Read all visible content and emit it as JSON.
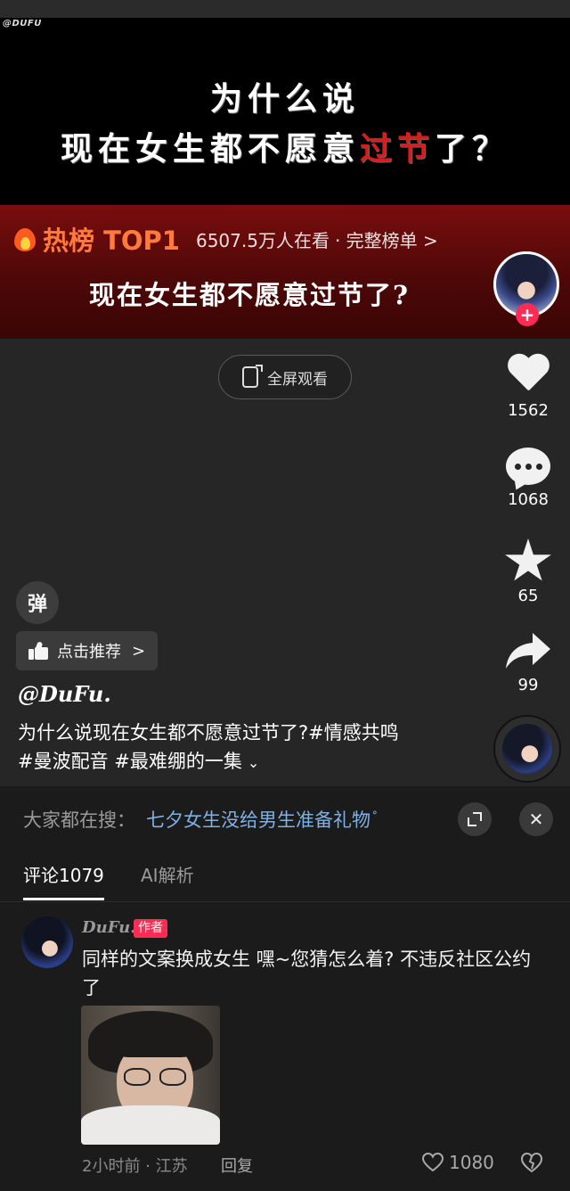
{
  "video": {
    "watermark": "@DUFU",
    "title_line1": "为什么说",
    "title_line2_prefix": "现在女生都不愿意",
    "title_line2_red": "过节",
    "title_line2_suffix": "了？",
    "hot_label": "热榜 TOP1",
    "hot_count": "6507.5万人在看",
    "hot_full_list": "· 完整榜单 >",
    "hot_title": "现在女生都不愿意过节了?",
    "fullscreen_label": "全屏观看"
  },
  "actions": {
    "follow_plus": "+",
    "likes": "1562",
    "comments": "1068",
    "favorites": "65",
    "shares": "99"
  },
  "overlay": {
    "danmu_label": "弹",
    "recommend_label": "点击推荐",
    "recommend_chevron": ">",
    "author": "@DuFu.",
    "description_line1": "为什么说现在女生都不愿意过节了?#情感共鸣",
    "description_line2": "#曼波配音 #最难绷的一集",
    "expand_glyph": "⌄"
  },
  "comments_sheet": {
    "search_prefix": "大家都在搜：",
    "search_term": "七夕女生没给男生准备礼物",
    "search_glyph": "ᐤ",
    "close_glyph": "✕",
    "tabs": [
      {
        "label": "评论1079",
        "active": true
      },
      {
        "label": "AI解析",
        "active": false
      }
    ],
    "comment": {
      "name": "DuFu.",
      "badge": "作者",
      "text": "同样的文案换成女生 嘿~您猜怎么着? 不违反社区公约了",
      "meta": "2小时前 · 江苏",
      "reply": "回复",
      "likes": "1080"
    }
  },
  "colors": {
    "accent_red": "#fe2c55",
    "title_red": "#d81b1b",
    "hot_orange": "#ff7a3c",
    "search_blue": "#7fb0e6"
  },
  "icons": [
    "heart-icon",
    "comment-icon",
    "star-icon",
    "share-icon",
    "fullscreen-icon",
    "thumbs-up-icon",
    "expand-icon",
    "close-icon",
    "dislike-icon",
    "flame-icon"
  ]
}
